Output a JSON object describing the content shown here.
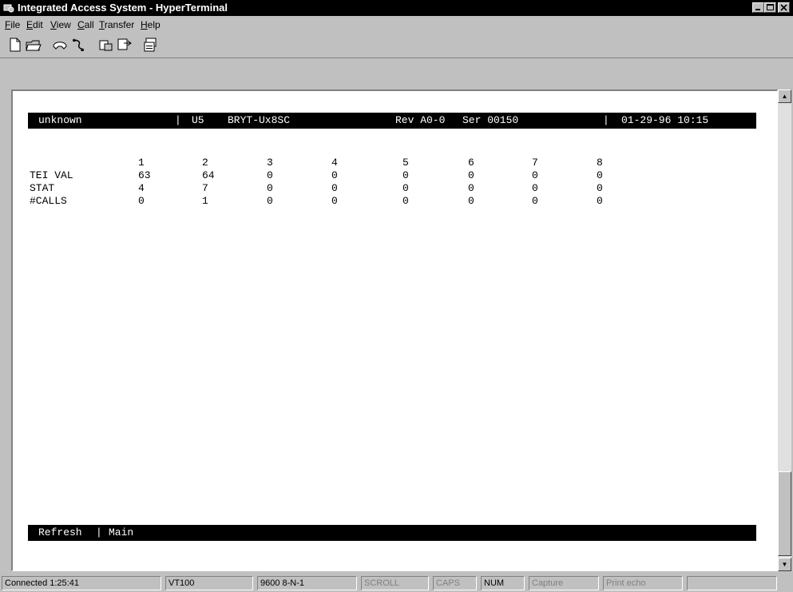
{
  "window": {
    "title": "Integrated Access System - HyperTerminal",
    "controls": {
      "minimize": "_",
      "maximize": "□",
      "close": "×"
    }
  },
  "menu": [
    "File",
    "Edit",
    "View",
    "Call",
    "Transfer",
    "Help"
  ],
  "toolbar": {
    "icons": [
      "new-icon",
      "open-icon",
      "connect-icon",
      "disconnect-icon",
      "send-icon",
      "receive-icon",
      "properties-icon"
    ]
  },
  "terminal": {
    "header": {
      "node": "unknown",
      "sep1": "|",
      "slot": "U5",
      "card": "BRYT-Ux8SC",
      "rev": "Rev A0-0",
      "ser": "Ser 00150",
      "sep2": "|",
      "datetime": "01-29-96 10:15"
    },
    "columns": [
      "1",
      "2",
      "3",
      "4",
      "5",
      "6",
      "7",
      "8"
    ],
    "rows": [
      {
        "label": "TEI VAL",
        "values": [
          "63",
          "64",
          "0",
          "0",
          "0",
          "0",
          "0",
          "0"
        ]
      },
      {
        "label": "STAT",
        "values": [
          "4",
          "7",
          "0",
          "0",
          "0",
          "0",
          "0",
          "0"
        ]
      },
      {
        "label": "#CALLS",
        "values": [
          "0",
          "1",
          "0",
          "0",
          "0",
          "0",
          "0",
          "0"
        ]
      }
    ],
    "footer": {
      "refresh": "Refresh",
      "sep": "|",
      "main": "Main"
    }
  },
  "statusbar": {
    "connected": "Connected 1:25:41",
    "emulation": "VT100",
    "settings": "9600 8-N-1",
    "scroll": "SCROLL",
    "caps": "CAPS",
    "num": "NUM",
    "capture": "Capture",
    "print_echo": "Print echo"
  },
  "scrollbar": {
    "up": "▲",
    "down": "▼"
  }
}
